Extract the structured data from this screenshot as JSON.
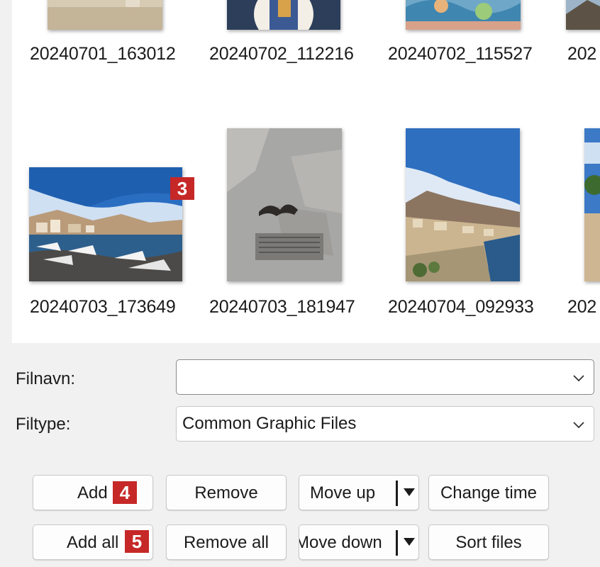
{
  "thumbnails": [
    {
      "name": "20240701_163012"
    },
    {
      "name": "20240702_112216"
    },
    {
      "name": "20240702_115527"
    },
    {
      "name": "202"
    },
    {
      "name": "20240703_173649"
    },
    {
      "name": "20240703_181947"
    },
    {
      "name": "20240704_092933"
    },
    {
      "name": "202"
    }
  ],
  "badges": {
    "b3": "3",
    "b4": "4",
    "b5": "5"
  },
  "fields": {
    "filename": {
      "label": "Filnavn:",
      "value": ""
    },
    "filetype": {
      "label": "Filtype:",
      "value": "Common Graphic Files"
    }
  },
  "buttons": {
    "add": "Add",
    "add_all": "Add all",
    "remove": "Remove",
    "remove_all": "Remove all",
    "move_up": "Move up",
    "move_down": "Move down",
    "change_time": "Change time",
    "sort_files": "Sort files"
  },
  "colors": {
    "badge": "#c62828"
  }
}
